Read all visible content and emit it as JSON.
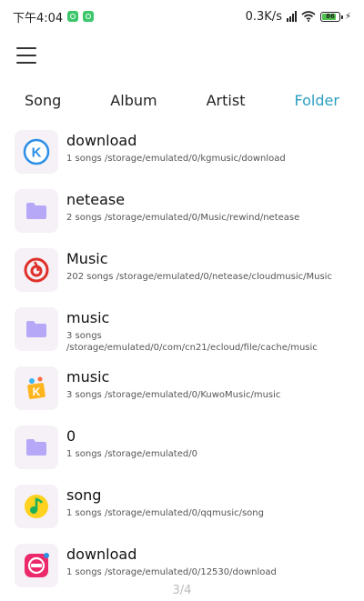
{
  "status": {
    "time": "下午4:04",
    "speed": "0.3K/s",
    "battery": "86",
    "battery_level": 0.86
  },
  "tabs": [
    {
      "label": "Song"
    },
    {
      "label": "Album"
    },
    {
      "label": "Artist"
    },
    {
      "label": "Folder",
      "active": true
    }
  ],
  "folders": [
    {
      "name": "download",
      "meta": "1 songs /storage/emulated/0/kgmusic/download",
      "icon": "kugou-icon"
    },
    {
      "name": "netease",
      "meta": "2 songs /storage/emulated/0/Music/rewind/netease",
      "icon": "folder-icon"
    },
    {
      "name": "Music",
      "meta": "202 songs /storage/emulated/0/netease/cloudmusic/Music",
      "icon": "netease-cloud-music-icon"
    },
    {
      "name": "music",
      "meta": "3 songs /storage/emulated/0/com/cn21/ecloud/file/cache/music",
      "icon": "folder-icon"
    },
    {
      "name": "music",
      "meta": "3 songs /storage/emulated/0/KuwoMusic/music",
      "icon": "kuwo-icon"
    },
    {
      "name": "0",
      "meta": "1 songs /storage/emulated/0",
      "icon": "folder-icon"
    },
    {
      "name": "song",
      "meta": "1 songs /storage/emulated/0/qqmusic/song",
      "icon": "qq-music-icon"
    },
    {
      "name": "download",
      "meta": "1 songs /storage/emulated/0/12530/download",
      "icon": "migu-music-icon"
    }
  ],
  "page_indicator": "3/4",
  "colors": {
    "accent": "#2a9fc1",
    "folder": "#b6a8f7"
  }
}
